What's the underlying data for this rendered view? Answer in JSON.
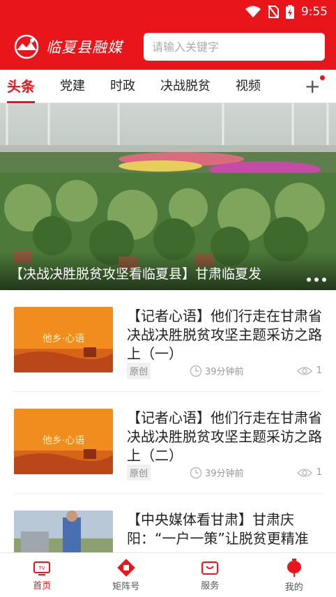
{
  "status": {
    "time": "9:55"
  },
  "header": {
    "logo_text": "临夏县融媒",
    "search_placeholder": "请输入关键字"
  },
  "tabs": [
    {
      "label": "头条",
      "active": true
    },
    {
      "label": "党建"
    },
    {
      "label": "时政"
    },
    {
      "label": "决战脱贫"
    },
    {
      "label": "视频"
    }
  ],
  "tab_add_label": "+",
  "banner": {
    "caption": "【决战决胜脱贫攻坚看临夏县】甘肃临夏发"
  },
  "news": [
    {
      "title": "【记者心语】他们行走在甘肃省决战决胜脱贫攻坚主题采访之路上（一）",
      "badge": "原创",
      "time": "39分钟前",
      "views": "1",
      "thumb_text": "他乡·心语"
    },
    {
      "title": "【记者心语】他们行走在甘肃省决战决胜脱贫攻坚主题采访之路上（二）",
      "badge": "原创",
      "time": "39分钟前",
      "views": "1",
      "thumb_text": "他乡·心语"
    },
    {
      "title": "【中央媒体看甘肃】甘肃庆阳：“一户一策”让脱贫更精准",
      "badge": "",
      "time": "",
      "views": ""
    }
  ],
  "bottom_nav": [
    {
      "label": "首页",
      "icon": "tv-icon",
      "active": true
    },
    {
      "label": "矩阵号",
      "icon": "matrix-icon"
    },
    {
      "label": "服务",
      "icon": "service-icon"
    },
    {
      "label": "我的",
      "icon": "lantern-icon"
    }
  ],
  "colors": {
    "brand": "#e8161b"
  }
}
